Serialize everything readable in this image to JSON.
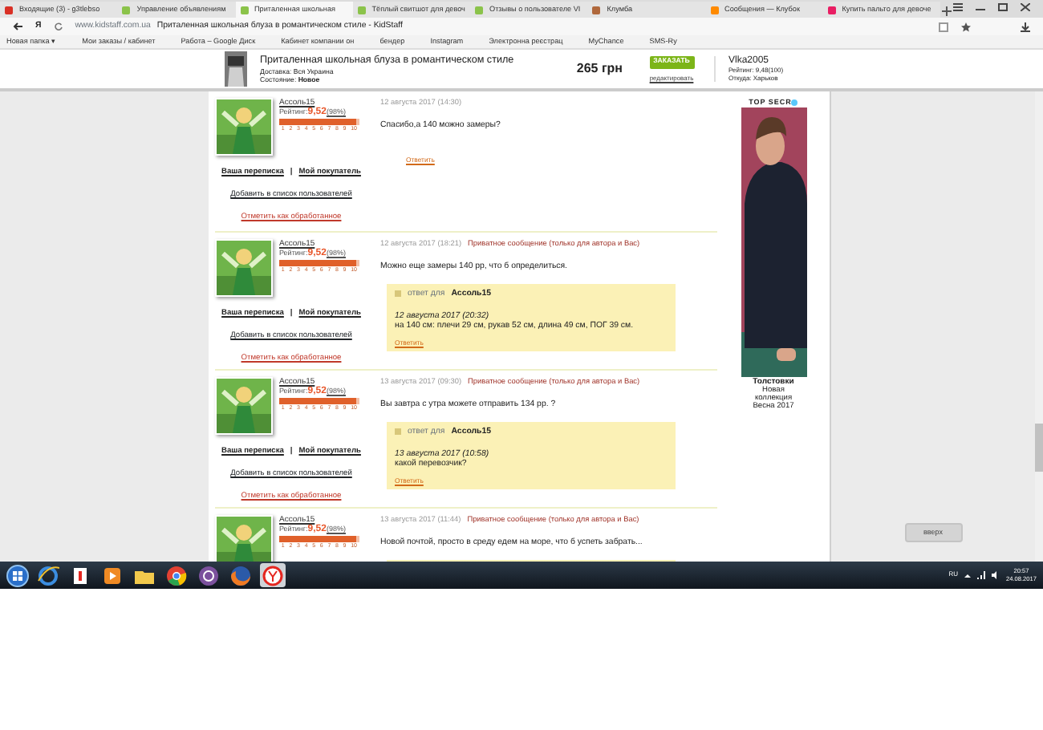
{
  "browser": {
    "tabs": [
      {
        "title": "Входящие (3) - g3tlebso",
        "selected": false,
        "color": "#d93025"
      },
      {
        "title": "Управление объявлениям",
        "selected": false,
        "color": "#8bc34a"
      },
      {
        "title": "Приталенная школьная",
        "selected": true,
        "color": "#8bc34a"
      },
      {
        "title": "Тёплый свитшот для девоч",
        "selected": false,
        "color": "#8bc34a"
      },
      {
        "title": "Отзывы о пользователе VI",
        "selected": false,
        "color": "#8bc34a"
      },
      {
        "title": "Клумба",
        "selected": false,
        "color": "#b0683c"
      },
      {
        "title": "Сообщения — Клубок",
        "selected": false,
        "color": "#ff8a00"
      },
      {
        "title": "Купить пальто для девоче",
        "selected": false,
        "color": "#e91e63"
      }
    ],
    "yandex_button": "Я",
    "address": "www.kidstaff.com.ua",
    "page_title": "Приталенная школьная блуза в романтическом стиле - KidStaff",
    "bookmarks": [
      "Новая папка ▾",
      "Мои заказы / кабинет",
      "Работа – Google Диск",
      "Кабинет компании он",
      "бендер",
      "Instagram",
      "Электронна реєстрац",
      "MyChance",
      "SMS-Ry"
    ]
  },
  "product_bar": {
    "title": "Приталенная школьная блуза в романтическом стиле",
    "delivery": "Доставка: Вся Украина",
    "condition": "Состояние: **Новое**",
    "price": "265 грн",
    "order_button": "ЗАКАЗАТЬ",
    "edit_link": "редактировать",
    "seller": "Vlka2005",
    "seller_rating": "Рейтинг: 9,48(100)",
    "seller_city": "Откуда: Харьков"
  },
  "messages": [
    {
      "author": "Ассоль15",
      "rating_label": "Рейтинг:",
      "rating": "9,52",
      "rating_percent": "(98%)",
      "level": 0.95,
      "scale": [
        "1",
        "2",
        "3",
        "4",
        "5",
        "6",
        "7",
        "8",
        "9",
        "10"
      ],
      "links": [
        "Ваша переписка",
        "Мой покупатель"
      ],
      "separator": "|",
      "add_link": "Добавить в список пользователей",
      "mark_link": "Отметить как обработанное",
      "date": "12 августа 2017 (14:30)",
      "text": "Спасибо,а 140 можно замеры?",
      "reply": "Ответить"
    },
    {
      "author": "Ассоль15",
      "rating_label": "Рейтинг:",
      "rating": "9,52",
      "rating_percent": "(98%)",
      "level": 0.95,
      "scale": [
        "1",
        "2",
        "3",
        "4",
        "5",
        "6",
        "7",
        "8",
        "9",
        "10"
      ],
      "links": [
        "Ваша переписка",
        "Мой покупатель"
      ],
      "separator": "|",
      "add_link": "Добавить в список пользователей",
      "mark_link": "Отметить как обработанное",
      "date": "12 августа 2017 (18:21)",
      "private": "Приватное сообщение (только для автора и Вас)",
      "text": "Можно еще замеры 140 рр, что б определиться.",
      "quote": {
        "label": "ответ для",
        "name": "Ассоль15",
        "date": "12 августа 2017 (20:32)",
        "text": "на 140 см: плечи 29 см, рукав 52 см, длина 49 см, ПОГ 39 см.",
        "reply": "Ответить"
      }
    },
    {
      "author": "Ассоль15",
      "rating_label": "Рейтинг:",
      "rating": "9,52",
      "rating_percent": "(98%)",
      "level": 0.95,
      "scale": [
        "1",
        "2",
        "3",
        "4",
        "5",
        "6",
        "7",
        "8",
        "9",
        "10"
      ],
      "links": [
        "Ваша переписка",
        "Мой покупатель"
      ],
      "separator": "|",
      "add_link": "Добавить в список пользователей",
      "mark_link": "Отметить как обработанное",
      "date": "13 августа 2017 (09:30)",
      "private": "Приватное сообщение (только для автора и Вас)",
      "text": "Вы завтра с утра можете отправить 134 рр. ?",
      "quote": {
        "label": "ответ для",
        "name": "Ассоль15",
        "date": "13 августа 2017 (10:58)",
        "text": "какой перевозчик?",
        "reply": "Ответить"
      }
    },
    {
      "author": "Ассоль15",
      "rating_label": "Рейтинг:",
      "rating": "9,52",
      "rating_percent": "(98%)",
      "level": 0.95,
      "scale": [
        "1",
        "2",
        "3",
        "4",
        "5",
        "6",
        "7",
        "8",
        "9",
        "10"
      ],
      "date": "13 августа 2017 (11:44)",
      "private": "Приватное сообщение (только для автора и Вас)",
      "text": "Новой почтой, просто в среду едем на море, что б успеть забрать...",
      "quote_cut": true
    }
  ],
  "ad": {
    "brand": "TOP SECR",
    "title": "Толстовки",
    "lines": [
      "Новая",
      "коллекция",
      "Весна 2017"
    ]
  },
  "up_button": "вверх",
  "taskbar": {
    "apps": [
      {
        "kind": "ie",
        "selected": false
      },
      {
        "kind": "yandex",
        "selected": false
      },
      {
        "kind": "media",
        "selected": false
      },
      {
        "kind": "folder",
        "selected": false
      },
      {
        "kind": "chrome",
        "selected": false
      },
      {
        "kind": "viber",
        "selected": false
      },
      {
        "kind": "firefox",
        "selected": false
      },
      {
        "kind": "ybrowser",
        "selected": true
      }
    ],
    "language": "RU",
    "time": "20:57",
    "date": "24.08.2017"
  }
}
